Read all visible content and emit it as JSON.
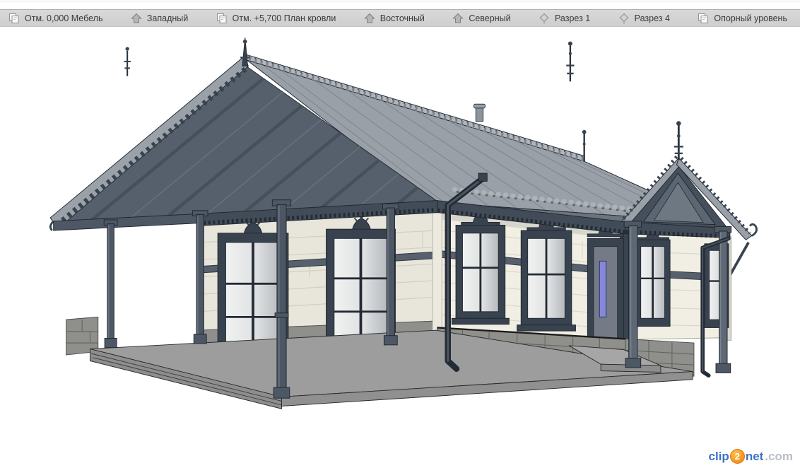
{
  "tab_bar": {
    "tabs": [
      {
        "label": "Отм. 0,000 Мебель",
        "icon": "floor-plan-icon"
      },
      {
        "label": "Западный",
        "icon": "elevation-icon"
      },
      {
        "label": "Отм. +5,700 План кровли",
        "icon": "floor-plan-icon"
      },
      {
        "label": "Восточный",
        "icon": "elevation-icon"
      },
      {
        "label": "Северный",
        "icon": "elevation-icon"
      },
      {
        "label": "Разрез 1",
        "icon": "section-icon"
      },
      {
        "label": "Разрез 4",
        "icon": "section-icon"
      },
      {
        "label": "Опорный уровень",
        "icon": "floor-plan-icon"
      }
    ]
  },
  "viewport": {
    "scene": "3d-shaded-view-wooden-station-house"
  },
  "watermark": {
    "clip": "clip",
    "badge": "2",
    "net": "net",
    "suffix": ".com"
  },
  "colors": {
    "tabbar_bg": "#d4d4d4",
    "roof_light": "#9aa0a7",
    "roof_dark": "#56606c",
    "trim_dark": "#39434f",
    "wall_cream": "#f1eee3",
    "stone": "#8f8f8c",
    "terrace": "#9d9d9d",
    "door_glass": "#8487da",
    "watermark_blue": "#3c72c6",
    "watermark_orange": "#f5921e",
    "watermark_gray": "#b9bfc6"
  }
}
